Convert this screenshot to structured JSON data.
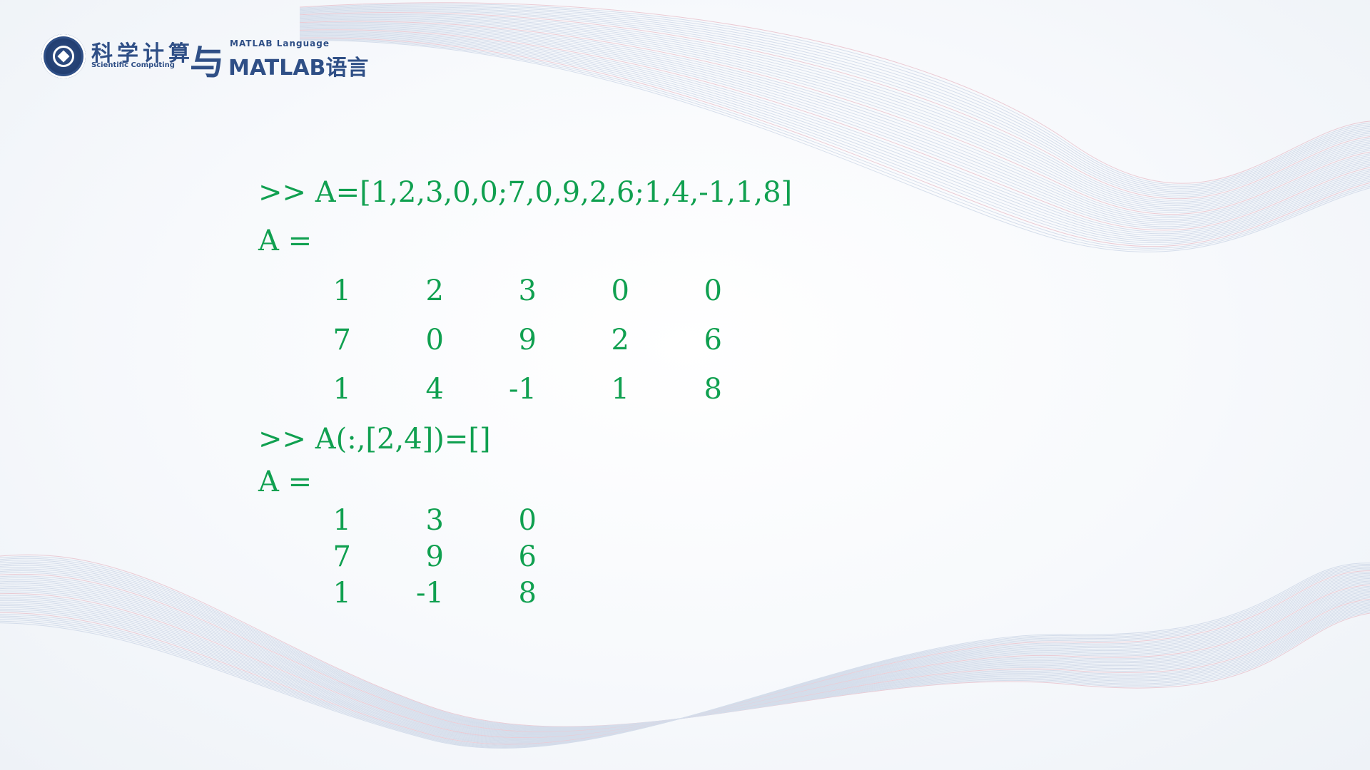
{
  "logo": {
    "title_zh": "科学计算",
    "yu": "与",
    "subtitle_en": "Scientific Computing",
    "matlab_small": "MATLAB Language",
    "matlab_big": "MATLAB语言"
  },
  "console": {
    "cmd1": ">> A=[1,2,3,0,0;7,0,9,2,6;1,4,-1,1,8]",
    "out1_label": "A =",
    "matrix1": [
      [
        "1",
        "2",
        "3",
        "0",
        "0"
      ],
      [
        "7",
        "0",
        "9",
        "2",
        "6"
      ],
      [
        "1",
        "4",
        "-1",
        "1",
        "8"
      ]
    ],
    "cmd2": ">> A(:,[2,4])=[]",
    "out2_label": "A =",
    "matrix2": [
      [
        "1",
        "3",
        "0"
      ],
      [
        "7",
        "9",
        "6"
      ],
      [
        "1",
        "-1",
        "8"
      ]
    ]
  },
  "colors": {
    "code": "#10a050",
    "brand": "#2f4f86"
  }
}
